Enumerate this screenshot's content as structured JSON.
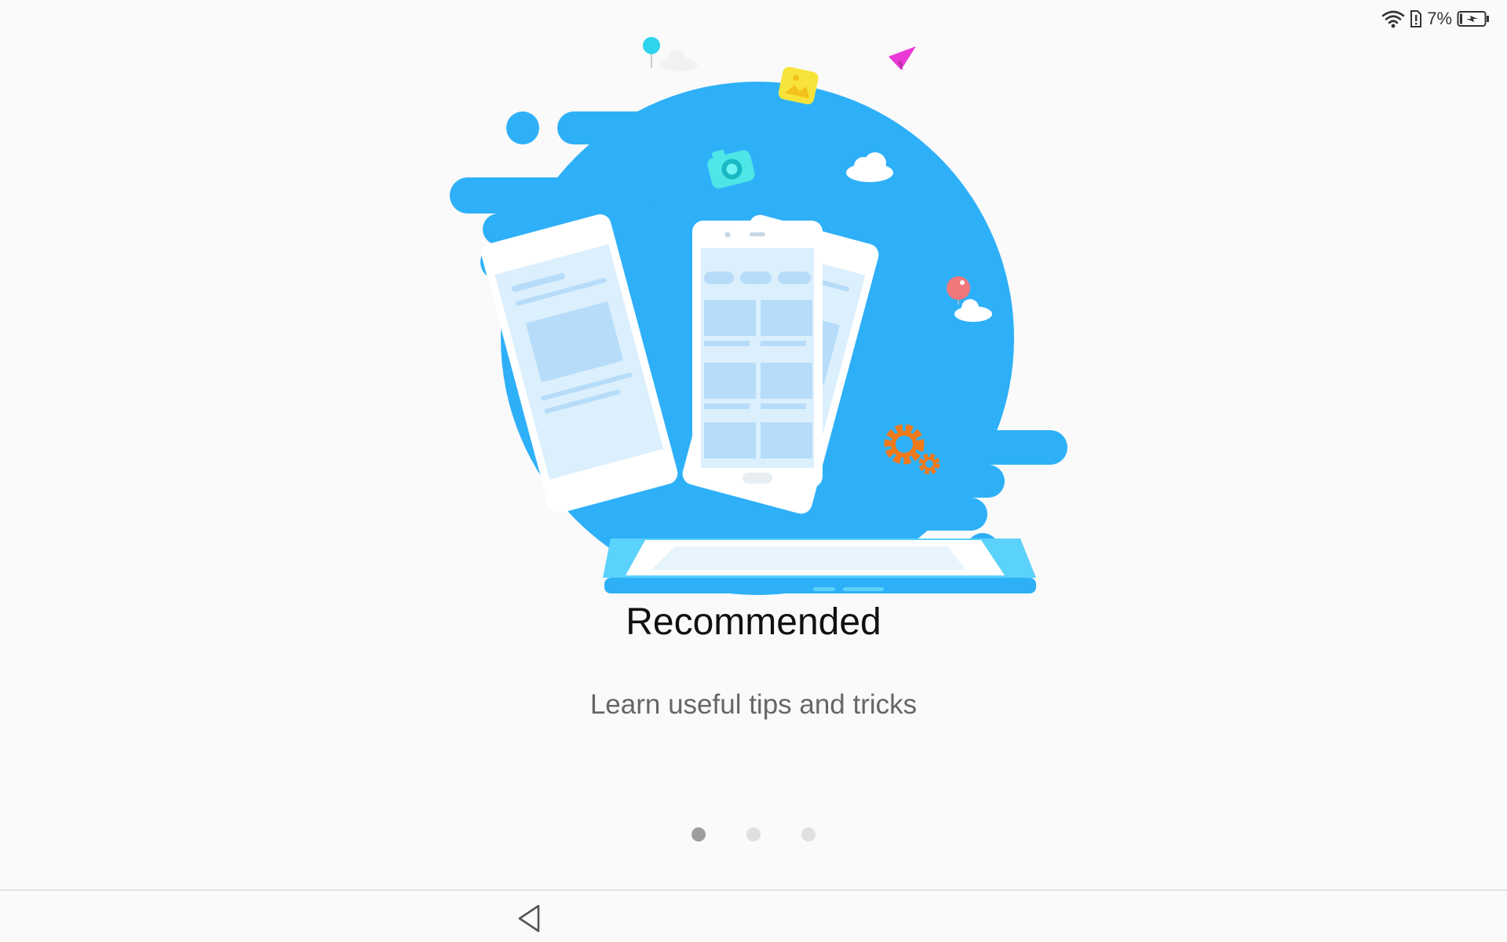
{
  "status_bar": {
    "battery_percent": "7%",
    "icons": [
      "wifi-icon",
      "sim-alert-icon",
      "battery-charging-icon"
    ]
  },
  "onboarding": {
    "title": "Recommended",
    "subtitle": "Learn useful tips and tricks",
    "page_count": 3,
    "current_page": 1
  },
  "navigation": {
    "icons": [
      "back-icon"
    ]
  },
  "colors": {
    "blob_blue": "#2eb0f8",
    "tablet_blue": "#5bd2fb",
    "gear_orange": "#f07a1c"
  }
}
